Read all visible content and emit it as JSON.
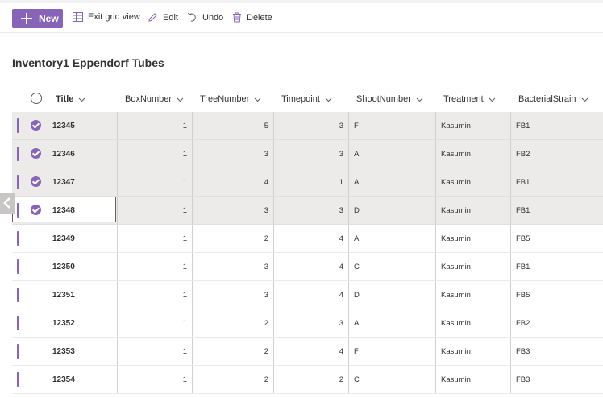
{
  "toolbar": {
    "new_label": "New",
    "exit_grid_label": "Exit grid view",
    "edit_label": "Edit",
    "undo_label": "Undo",
    "delete_label": "Delete"
  },
  "list_title": "Inventory1 Eppendorf Tubes",
  "columns": {
    "title": "Title",
    "box": "BoxNumber",
    "tree": "TreeNumber",
    "timepoint": "Timepoint",
    "shoot": "ShootNumber",
    "treatment": "Treatment",
    "strain": "BacterialStrain"
  },
  "rows": [
    {
      "title": "12345",
      "box": "1",
      "tree": "5",
      "timepoint": "3",
      "shoot": "F",
      "treatment": "Kasumin",
      "strain": "FB1",
      "selected": true
    },
    {
      "title": "12346",
      "box": "1",
      "tree": "3",
      "timepoint": "3",
      "shoot": "A",
      "treatment": "Kasumin",
      "strain": "FB2",
      "selected": true
    },
    {
      "title": "12347",
      "box": "1",
      "tree": "4",
      "timepoint": "1",
      "shoot": "A",
      "treatment": "Kasumin",
      "strain": "FB1",
      "selected": true
    },
    {
      "title": "12348",
      "box": "1",
      "tree": "3",
      "timepoint": "3",
      "shoot": "D",
      "treatment": "Kasumin",
      "strain": "FB1",
      "selected": true,
      "focused": true
    },
    {
      "title": "12349",
      "box": "1",
      "tree": "2",
      "timepoint": "4",
      "shoot": "A",
      "treatment": "Kasumin",
      "strain": "FB5",
      "selected": false
    },
    {
      "title": "12350",
      "box": "1",
      "tree": "3",
      "timepoint": "4",
      "shoot": "C",
      "treatment": "Kasumin",
      "strain": "FB1",
      "selected": false
    },
    {
      "title": "12351",
      "box": "1",
      "tree": "3",
      "timepoint": "4",
      "shoot": "D",
      "treatment": "Kasumin",
      "strain": "FB5",
      "selected": false
    },
    {
      "title": "12352",
      "box": "1",
      "tree": "2",
      "timepoint": "3",
      "shoot": "A",
      "treatment": "Kasumin",
      "strain": "FB2",
      "selected": false
    },
    {
      "title": "12353",
      "box": "1",
      "tree": "2",
      "timepoint": "4",
      "shoot": "F",
      "treatment": "Kasumin",
      "strain": "FB3",
      "selected": false
    },
    {
      "title": "12354",
      "box": "1",
      "tree": "2",
      "timepoint": "2",
      "shoot": "C",
      "treatment": "Kasumin",
      "strain": "FB3",
      "selected": false
    }
  ],
  "colors": {
    "accent": "#8764b8",
    "selected_row_bg": "#edebe9"
  }
}
